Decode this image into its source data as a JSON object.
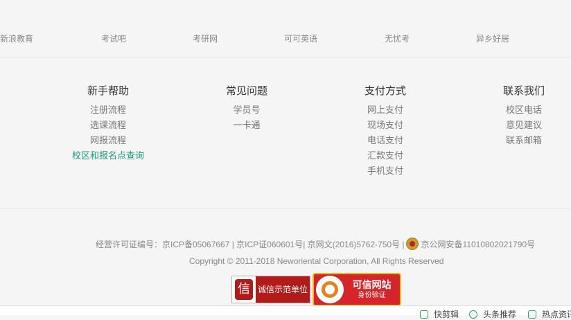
{
  "links": [
    "新浪教育",
    "考试吧",
    "考研网",
    "可可英语",
    "无忧考",
    "异乡好居"
  ],
  "help_columns": [
    {
      "title": "新手帮助",
      "items": [
        "注册流程",
        "选课流程",
        "网报流程",
        "校区和报名点查询"
      ]
    },
    {
      "title": "常见问题",
      "items": [
        "学员号",
        "一卡通"
      ]
    },
    {
      "title": "支付方式",
      "items": [
        "网上支付",
        "现场支付",
        "电话支付",
        "汇款支付",
        "手机支付"
      ]
    },
    {
      "title": "联系我们",
      "items": [
        "校区电话",
        "意见建议",
        "联系邮箱"
      ]
    }
  ],
  "footer": {
    "license": "经营许可证编号：京ICP备05067667 | 京ICP证060601号| 京网文(2016)5762-750号 |",
    "police": "京公网安备11010802021790号",
    "copyright": "Copyright © 2011-2018 Neworiental Corporation, All Rights Reserved",
    "badge1": {
      "seal": "信",
      "text": "诚信示范单位"
    },
    "badge2": {
      "title": "可信网站",
      "sub": "身份验证"
    }
  },
  "bottom_bar": [
    "快剪辑",
    "头条推荐",
    "热点资讯"
  ],
  "colors": {
    "highlight": "#1a9a7f",
    "badge_red": "#b31b1b"
  }
}
